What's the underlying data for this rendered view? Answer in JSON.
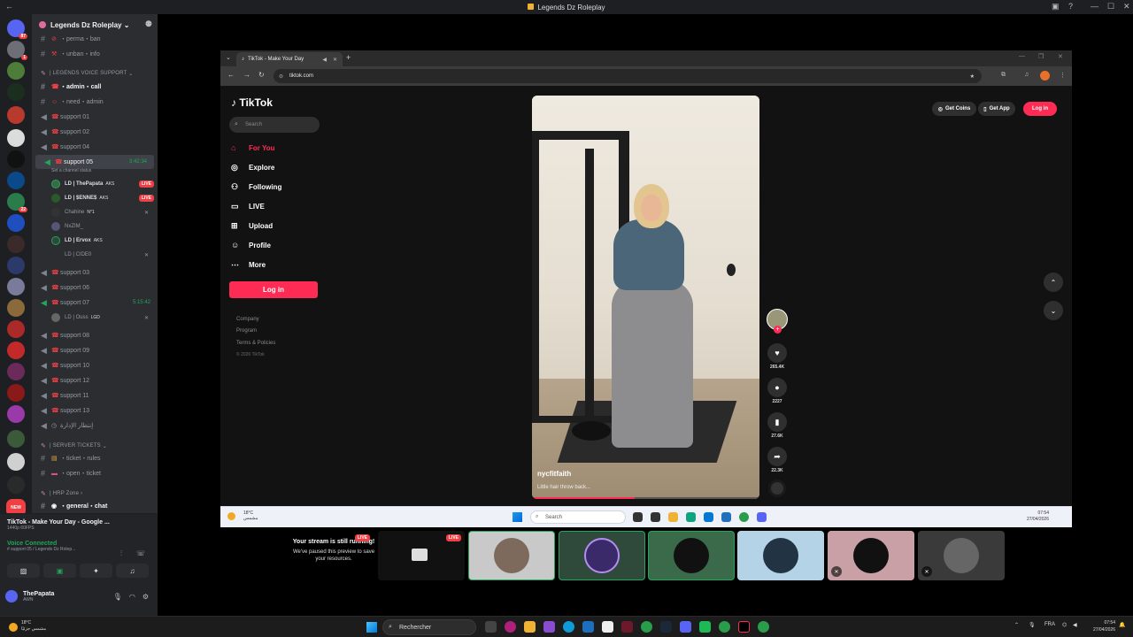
{
  "window": {
    "title": "Legends Dz Roleplay"
  },
  "guild": {
    "name": "Legends Dz Roleplay"
  },
  "servers": {
    "badge_top": "87",
    "badge_2": "1",
    "badge_22": "22",
    "new_label": "NEW"
  },
  "channels": {
    "c1": "・perma・ban",
    "c2": "・unban・info",
    "cat_voice": "| LEGENDS VOICE SUPPORT",
    "c3": "・admin・call",
    "c4": "・need・admin",
    "s01": "support 01",
    "s02": "support 02",
    "s04": "support 04",
    "s05": "support 05",
    "s05_timer": "3:42:34",
    "s05_status": "Set a channel status",
    "users": [
      {
        "name": "LD | ThePapata",
        "tag": "AKS",
        "live": "LIVE"
      },
      {
        "name": "LD | $ENNE$",
        "tag": "AKS",
        "live": "LIVE"
      },
      {
        "name": "Chahine",
        "tag": "N°1"
      },
      {
        "name": "NxZIM_"
      },
      {
        "name": "LD | Ervox",
        "tag": "AKS"
      },
      {
        "name": "LD | CIDE0"
      }
    ],
    "s03": "support 03",
    "s06": "support 06",
    "s07": "support 07",
    "s07_timer": "5:15:42",
    "s07_user": "LD | Ouss",
    "s07_tag": "LGD",
    "s08": "support 08",
    "s09": "support 09",
    "s10": "support 10",
    "s12": "support 12",
    "s11": "support 11",
    "s13": "support 13",
    "s_ar": "إنتظار الإدارة",
    "cat_tickets": "| SERVER TICKETS",
    "t1": "・ticket・rules",
    "t2": "・open・ticket",
    "cat_hrp": "| HRP Zone",
    "h1": "・general・chat"
  },
  "voice_panel": {
    "activity_title": "TikTok - Make Your Day - Google ...",
    "activity_sub": "1440p 60FPS",
    "connected": "Voice Connected",
    "connected_sub": "# support 05 / Legends Dz Rolep...",
    "user_name": "ThePapata",
    "user_status": "AWN"
  },
  "browser": {
    "tab_title": "TikTok - Make Your Day",
    "url": "tiktok.com"
  },
  "tiktok": {
    "logo": "TikTok",
    "search_placeholder": "Search",
    "nav": [
      "For You",
      "Explore",
      "Following",
      "LIVE",
      "Upload",
      "Profile",
      "More"
    ],
    "login": "Log in",
    "footer": [
      "Company",
      "Program",
      "Terms & Policies"
    ],
    "copyright": "© 2026 TikTok",
    "get_coins": "Get Coins",
    "get_app": "Get App",
    "header_login": "Log in",
    "video_user": "nycfitfaith",
    "video_caption": "Little hair throw back...",
    "likes": "265.4K",
    "comments": "2227",
    "saves": "27.6K",
    "shares": "22.3K",
    "progress": 0.45
  },
  "inner_taskbar": {
    "weather_temp": "18°C",
    "weather_desc": "مشمس",
    "search": "Search",
    "time": "07:54",
    "date": "27/04/2026"
  },
  "stream_paused": {
    "title": "Your stream is still running!",
    "sub": "We've paused this preview to save your resources.",
    "live": "LIVE",
    "live2": "LIVE"
  },
  "taskbar": {
    "weather_temp": "18°C",
    "weather_desc": "مشمس جزئيًا",
    "search": "Rechercher",
    "lang": "FRA",
    "time": "07:54",
    "date": "27/04/2026"
  }
}
